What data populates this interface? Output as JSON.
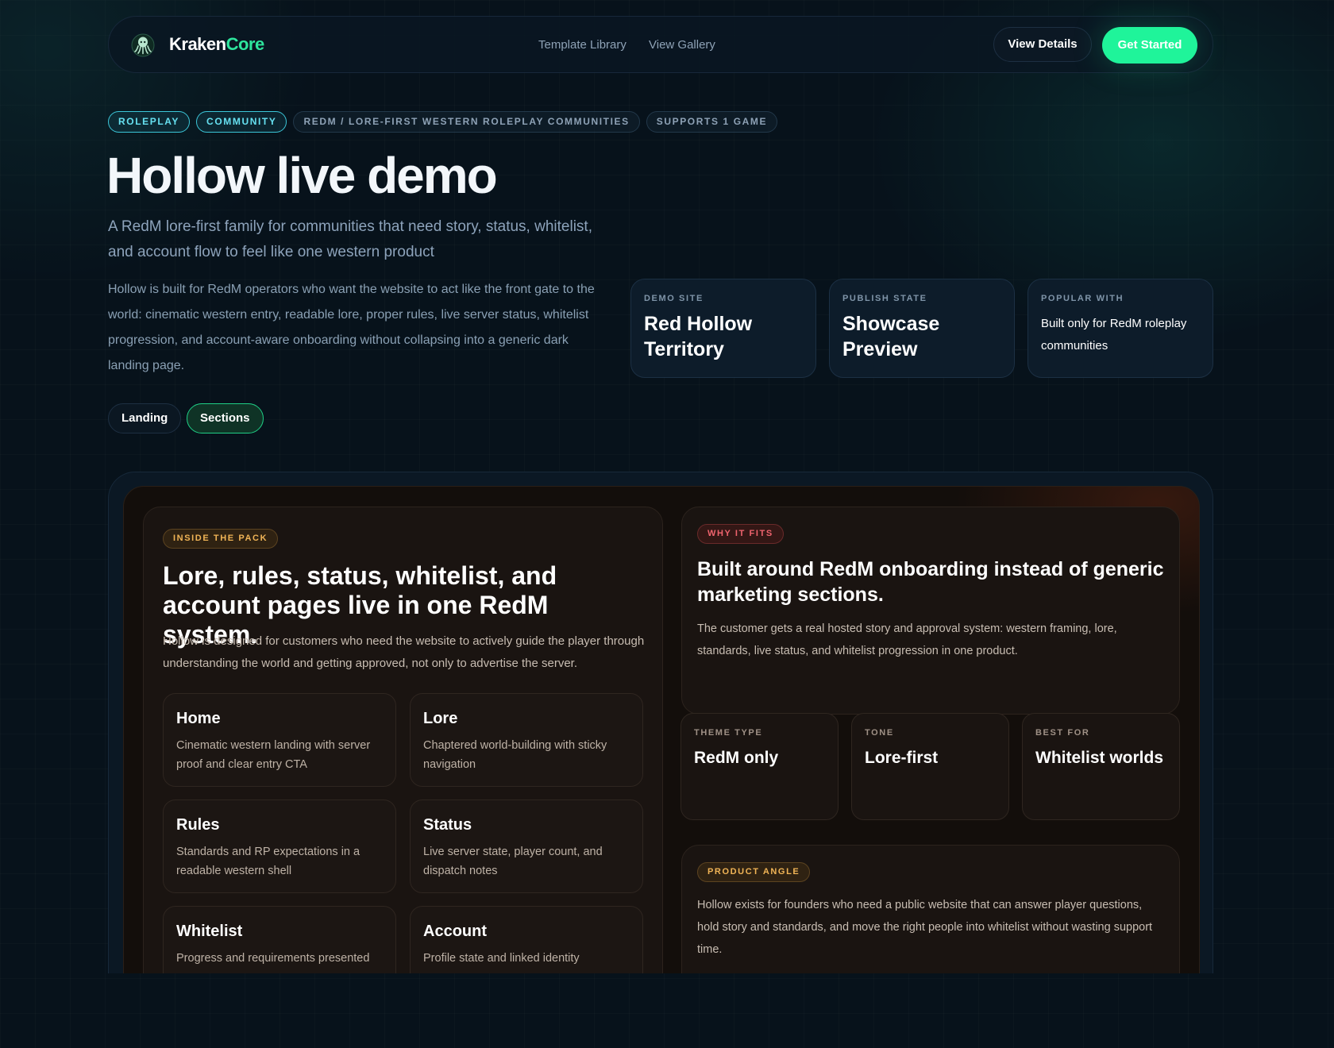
{
  "nav": {
    "brand_part1": "Kraken",
    "brand_part2": "Core",
    "links": [
      "Template Library",
      "View Gallery"
    ],
    "view_details": "View Details",
    "get_started": "Get Started"
  },
  "hero": {
    "tags": [
      "ROLEPLAY",
      "COMMUNITY",
      "REDM / LORE-FIRST WESTERN ROLEPLAY COMMUNITIES",
      "SUPPORTS 1 GAME"
    ],
    "title": "Hollow live demo",
    "subtitle": "A RedM lore-first family for communities that need story, status, whitelist, and account flow to feel like one western product",
    "body": "Hollow is built for RedM operators who want the website to act like the front gate to the world: cinematic western entry, readable lore, proper rules, live server status, whitelist progression, and account-aware onboarding without collapsing into a generic dark landing page.",
    "stats": [
      {
        "label": "DEMO SITE",
        "value": "Red Hollow Territory"
      },
      {
        "label": "PUBLISH STATE",
        "value": "Showcase Preview"
      },
      {
        "label": "POPULAR WITH",
        "value": "Built only for RedM roleplay communities"
      }
    ],
    "view_toggle": {
      "landing": "Landing",
      "sections": "Sections"
    }
  },
  "pack": {
    "tag": "INSIDE THE PACK",
    "heading": "Lore, rules, status, whitelist, and account pages live in one RedM system.",
    "text": "Hollow is designed for customers who need the website to actively guide the player through understanding the world and getting approved, not only to advertise the server.",
    "pages": [
      {
        "title": "Home",
        "desc": "Cinematic western landing with server proof and clear entry CTA"
      },
      {
        "title": "Lore",
        "desc": "Chaptered world-building with sticky navigation"
      },
      {
        "title": "Rules",
        "desc": "Standards and RP expectations in a readable western shell"
      },
      {
        "title": "Status",
        "desc": "Live server state, player count, and dispatch notes"
      },
      {
        "title": "Whitelist",
        "desc": "Progress and requirements presented"
      },
      {
        "title": "Account",
        "desc": "Profile state and linked identity"
      }
    ]
  },
  "fits": {
    "tag": "WHY IT FITS",
    "heading": "Built around RedM onboarding instead of generic marketing sections.",
    "text": "The customer gets a real hosted story and approval system: western framing, lore, standards, live status, and whitelist progression in one product."
  },
  "theme": [
    {
      "label": "THEME TYPE",
      "value": "RedM only"
    },
    {
      "label": "TONE",
      "value": "Lore-first"
    },
    {
      "label": "BEST FOR",
      "value": "Whitelist worlds"
    }
  ],
  "angle": {
    "tag": "PRODUCT ANGLE",
    "text": "Hollow exists for founders who need a public website that can answer player questions, hold story and standards, and move the right people into whitelist without wasting support time."
  },
  "colors": {
    "accent_green": "#1ff49a",
    "accent_cyan": "#3bc6d8",
    "accent_orange": "#f0b456",
    "accent_red": "#f0646e",
    "page_bg": "#07121b"
  }
}
